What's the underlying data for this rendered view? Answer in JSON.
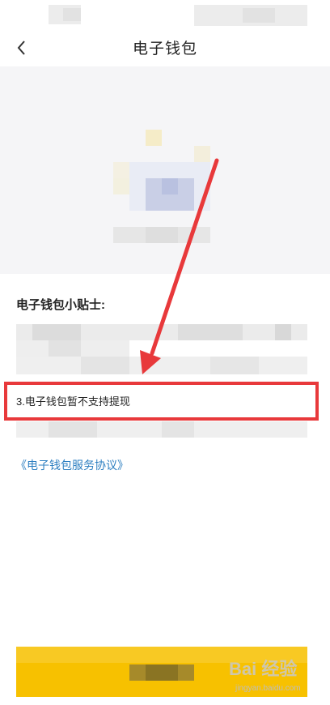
{
  "nav": {
    "title": "电子钱包",
    "back_icon": "chevron-left-icon"
  },
  "tips": {
    "title": "电子钱包小贴士:",
    "items": [
      {
        "index": 3,
        "text": "3.电子钱包暂不支持提现"
      }
    ]
  },
  "agreement_link": "《电子钱包服务协议》",
  "watermark": {
    "text": "Bai 经验",
    "sub": "jingyan.baidu.com"
  },
  "colors": {
    "accent_button": "#f7c100",
    "link": "#2d7fc1",
    "highlight": "#e8393b",
    "arrow": "#e8393b"
  }
}
